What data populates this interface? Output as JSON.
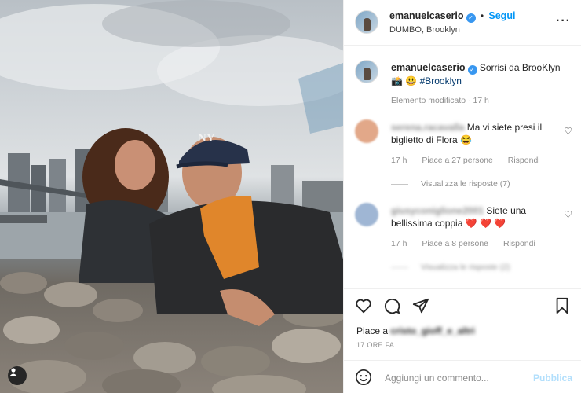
{
  "post": {
    "username": "emanuelcaserio",
    "follow_label": "Segui",
    "location": "DUMBO, Brooklyn",
    "more_icon": "more-icon",
    "caption_text": "Sorrisi da BrooKlyn",
    "caption_emojis": "📸 😃",
    "caption_hashtag": "#Brooklyn",
    "caption_meta": "Elemento modificato · 17 h",
    "photo_cap_text": "NY"
  },
  "comments": [
    {
      "username": "serena.racavalla",
      "text": "Ma vi siete presi il biglietto di Flora 😂",
      "time": "17 h",
      "likes": "Piace a 27 persone",
      "reply": "Rispondi",
      "view_replies": "Visualizza le risposte (7)",
      "avatar_color": "#e2a889"
    },
    {
      "username": "giusyconiglione2001",
      "text": "Siete una bellissima coppia ❤️ ❤️ ❤️",
      "time": "17 h",
      "likes": "Piace a 8 persone",
      "reply": "Rispondi",
      "view_replies": "Visualizza le risposte (2)",
      "avatar_color": "#9fb6d4"
    }
  ],
  "likes": {
    "prefix": "Piace a",
    "user": "cristo_gioff_e_altri",
    "time": "17 ORE FA"
  },
  "add_comment": {
    "placeholder": "Aggiungi un commento...",
    "publish_label": "Pubblica"
  },
  "colors": {
    "accent": "#0095f6",
    "publish_disabled": "#b2dffc",
    "hashtag": "#00376b",
    "heart_red": "#ed4956"
  }
}
